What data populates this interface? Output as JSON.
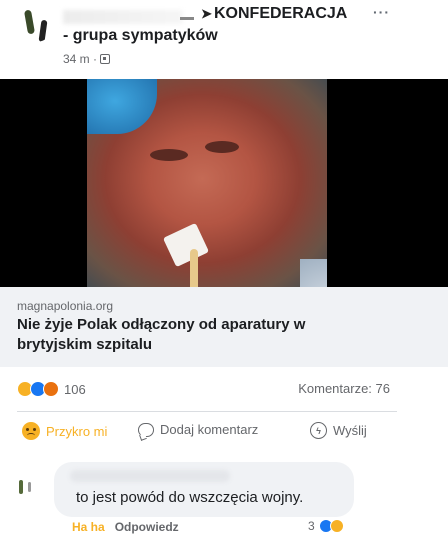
{
  "post": {
    "group_name": "KONFEDERACJA",
    "subline": "- grupa sympatyków",
    "time": "34 m ·",
    "more": "···"
  },
  "link": {
    "domain": "magnapolonia.org",
    "title": "Nie żyje Polak odłączony od aparatury w brytyjskim szpitalu"
  },
  "stats": {
    "reaction_count": "106",
    "comments": "Komentarze: 76"
  },
  "actions": {
    "react_label": "Przykro mi",
    "comment_label": "Dodaj komentarz",
    "send_label": "Wyślij"
  },
  "comment": {
    "text": "to jest powód do wszczęcia wojny.",
    "haha_label": "Ha ha",
    "reply_label": "Odpowiedz",
    "reaction_count": "3"
  },
  "colors": {
    "sad": "#f7b125",
    "like": "#1877f2",
    "angry": "#e9710f"
  }
}
